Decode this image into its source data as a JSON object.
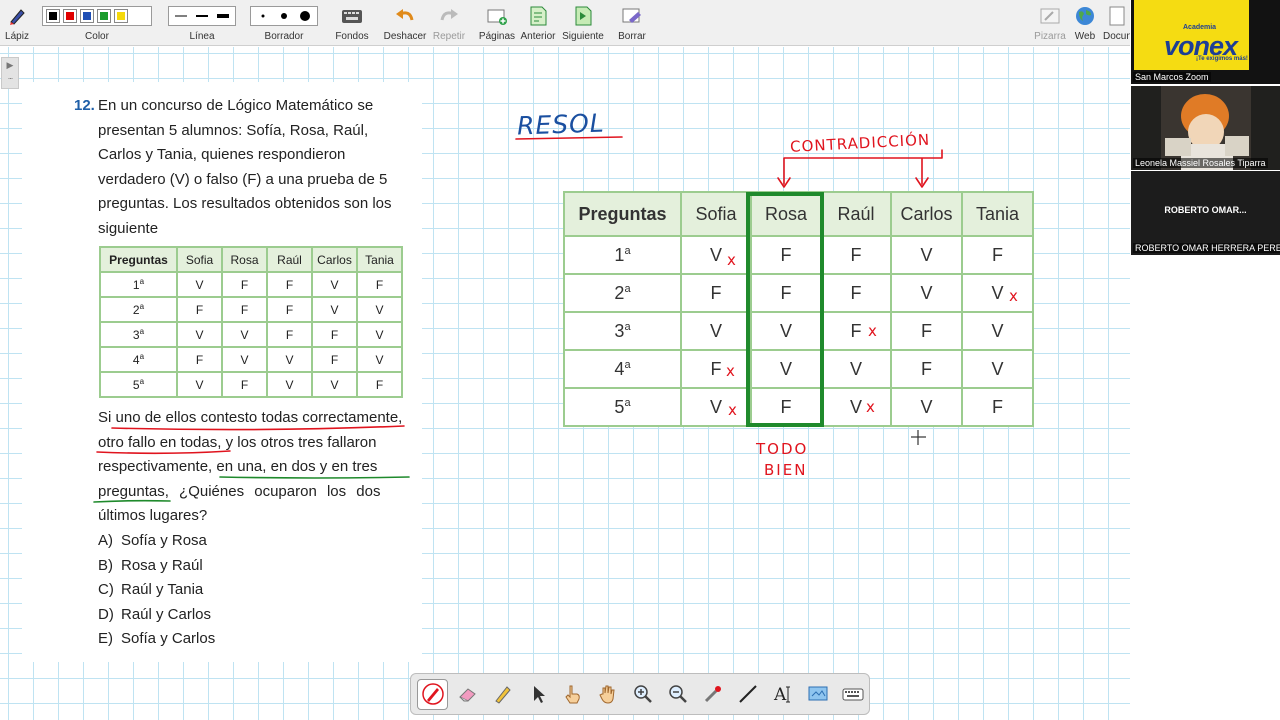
{
  "toolbar": {
    "lapiz": "Lápiz",
    "color": "Color",
    "linea": "Línea",
    "borrador": "Borrador",
    "fondos": "Fondos",
    "deshacer": "Deshacer",
    "repetir": "Repetir",
    "paginas": "Páginas",
    "anterior": "Anterior",
    "siguiente": "Siguiente",
    "borrar": "Borrar",
    "pizarra": "Pizarra",
    "web": "Web",
    "documentos": "Docun",
    "colors": [
      "#000000",
      "#e00000",
      "#1f4fb5",
      "#1a9b2b",
      "#f5d90a"
    ]
  },
  "problem": {
    "number": "12.",
    "text_lines": [
      "En un concurso de Lógico Matemático se",
      "presentan 5 alumnos: Sofía, Rosa, Raúl,",
      "Carlos y Tania, quienes respondieron",
      "verdadero (V) o falso (F) a una prueba de 5",
      "preguntas. Los resultados obtenidos son los",
      "siguiente"
    ],
    "condition_lines": [
      "Si uno de ellos contesto todas correctamente,",
      "otro fallo en todas, y los otros tres fallaron",
      "respectivamente, en una, en dos y en tres",
      "preguntas, ¿Quiénes ocuparon los dos",
      "últimos lugares?"
    ],
    "options": [
      {
        "letter": "A)",
        "text": "Sofía y Rosa"
      },
      {
        "letter": "B)",
        "text": "Rosa y Raúl"
      },
      {
        "letter": "C)",
        "text": "Raúl y Tania"
      },
      {
        "letter": "D)",
        "text": "Raúl y Carlos"
      },
      {
        "letter": "E)",
        "text": "Sofía y Carlos"
      }
    ]
  },
  "table": {
    "headers": [
      "Preguntas",
      "Sofia",
      "Rosa",
      "Raúl",
      "Carlos",
      "Tania"
    ],
    "rows": [
      {
        "n": "1",
        "s": "a",
        "cells": [
          "V",
          "F",
          "F",
          "V",
          "F"
        ]
      },
      {
        "n": "2",
        "s": "a",
        "cells": [
          "F",
          "F",
          "F",
          "V",
          "V"
        ]
      },
      {
        "n": "3",
        "s": "a",
        "cells": [
          "V",
          "V",
          "F",
          "F",
          "V"
        ]
      },
      {
        "n": "4",
        "s": "a",
        "cells": [
          "F",
          "V",
          "V",
          "F",
          "V"
        ]
      },
      {
        "n": "5",
        "s": "a",
        "cells": [
          "V",
          "F",
          "V",
          "V",
          "F"
        ]
      }
    ]
  },
  "annotations": {
    "resol": "RESOL",
    "contradiccion": "CONTRADICCIÓN",
    "todo": "TODO",
    "bien": "BIEN",
    "cross_mark": "x",
    "ink_blue": "#1a4fa0",
    "ink_red": "#e0141e",
    "ink_green": "#1f8a2c"
  },
  "participants": {
    "logo_top": "Academia",
    "logo_name": "vonex",
    "logo_slogan": "¡Te exigimos más!",
    "p1": "San Marcos Zoom",
    "p2": "Leonela Massiel Rosales Tiparra",
    "p3_display": "ROBERTO  OMAR...",
    "p3": "ROBERTO OMAR HERRERA PEREZ"
  }
}
